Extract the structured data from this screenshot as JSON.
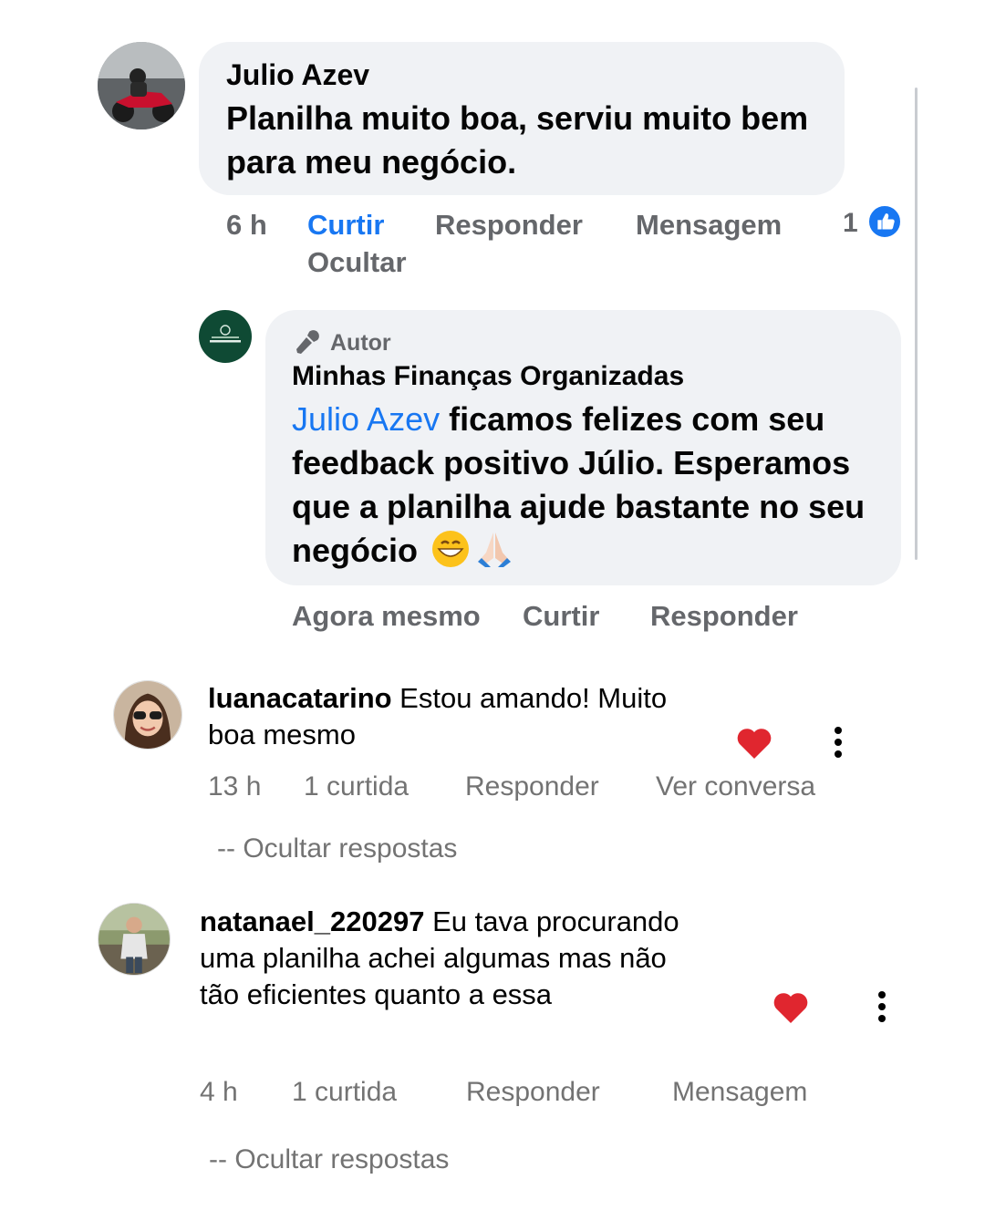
{
  "facebook": {
    "comment1": {
      "author": "Julio Azev",
      "text": "Planilha muito boa, serviu muito bem para meu negócio.",
      "time": "6 h",
      "actions": {
        "like": "Curtir",
        "reply": "Responder",
        "message": "Mensagem",
        "hide": "Ocultar"
      },
      "like_count": "1",
      "like_icon": "thumbs-up-icon"
    },
    "reply": {
      "badge": "Autor",
      "badge_icon": "microphone-icon",
      "author": "Minhas Finanças Organizadas",
      "mention": "Julio Azev",
      "text": " ficamos felizes com seu feedback positivo Júlio. Esperamos que a planilha ajude bastante no seu negócio",
      "emojis": [
        "grinning-face-icon",
        "folded-hands-icon"
      ],
      "time": "Agora mesmo",
      "actions": {
        "like": "Curtir",
        "reply": "Responder"
      }
    },
    "accent_color": "#1877f2"
  },
  "instagram": {
    "comments": [
      {
        "username": "luanacatarino",
        "text": " Estou amando! Muito boa mesmo",
        "time": "13 h",
        "likes": "1 curtida",
        "reply": "Responder",
        "extra": "Ver conversa",
        "hide_replies": "-- Ocultar respostas"
      },
      {
        "username": "natanael_220297",
        "text": " Eu tava procurando uma planilha achei algumas mas não tão eficientes quanto a essa",
        "time": "4 h",
        "likes": "1 curtida",
        "reply": "Responder",
        "extra": "Mensagem",
        "hide_replies": "-- Ocultar respostas"
      }
    ],
    "heart_color": "#e0262f"
  }
}
